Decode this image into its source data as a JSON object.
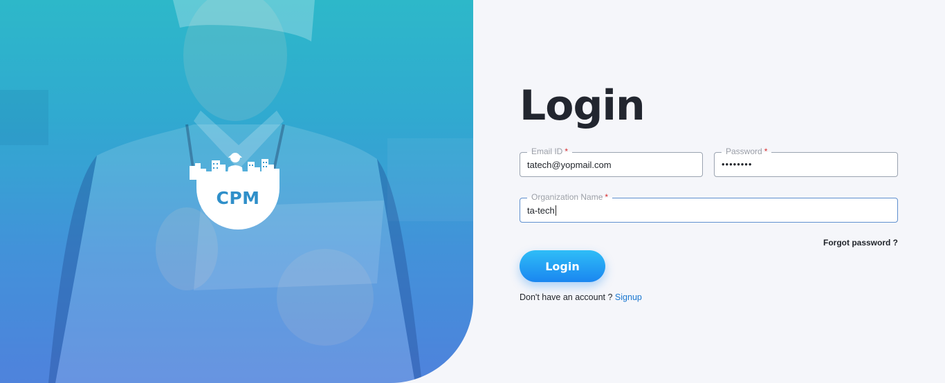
{
  "brand": {
    "logo_text": "CPM"
  },
  "login": {
    "title": "Login",
    "email": {
      "label": "Email ID",
      "required_mark": "*",
      "value": "tatech@yopmail.com"
    },
    "password": {
      "label": "Password",
      "required_mark": "*",
      "value": "••••••••"
    },
    "organization": {
      "label": "Organization Name",
      "required_mark": "*",
      "value": "ta-tech"
    },
    "forgot_label": "Forgot password ?",
    "submit_label": "Login",
    "signup_prompt": "Don't have an account ?",
    "signup_link": "Signup"
  },
  "colors": {
    "primary": "#1a86f0",
    "hero_top": "#27b6c8",
    "hero_bottom": "#4a7fdb",
    "title": "#22262f",
    "required": "#d82b2b"
  }
}
